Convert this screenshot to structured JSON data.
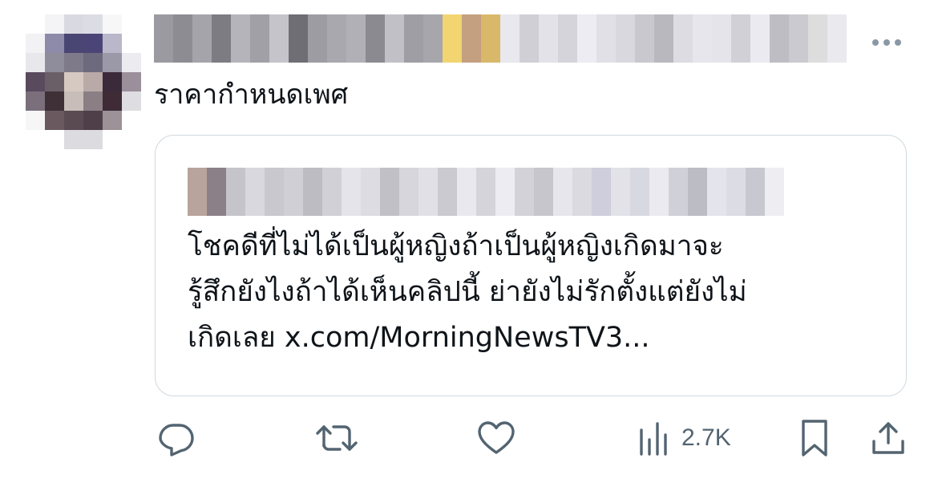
{
  "post": {
    "text": "ราคากำหนดเพศ",
    "more_label": "More"
  },
  "quote": {
    "lines": [
      "โชคดีที่ไม่ได้เป็นผู้หญิงถ้าเป็นผู้หญิงเกิดมาจะ",
      "รู้สึกยังไงถ้าได้เห็นคลิปนี้ ย่ายังไม่รักตั้งแต่ยังไม่",
      "เกิดเลย x.com/MorningNewsTV3..."
    ]
  },
  "actions": {
    "reply_icon": "reply-icon",
    "repost_icon": "repost-icon",
    "like_icon": "heart-icon",
    "views_icon": "analytics-icon",
    "views_count": "2.7K",
    "bookmark_icon": "bookmark-icon",
    "share_icon": "share-icon"
  },
  "colors": {
    "text": "#0f1419",
    "secondary": "#536471",
    "border": "#cfd9de"
  }
}
